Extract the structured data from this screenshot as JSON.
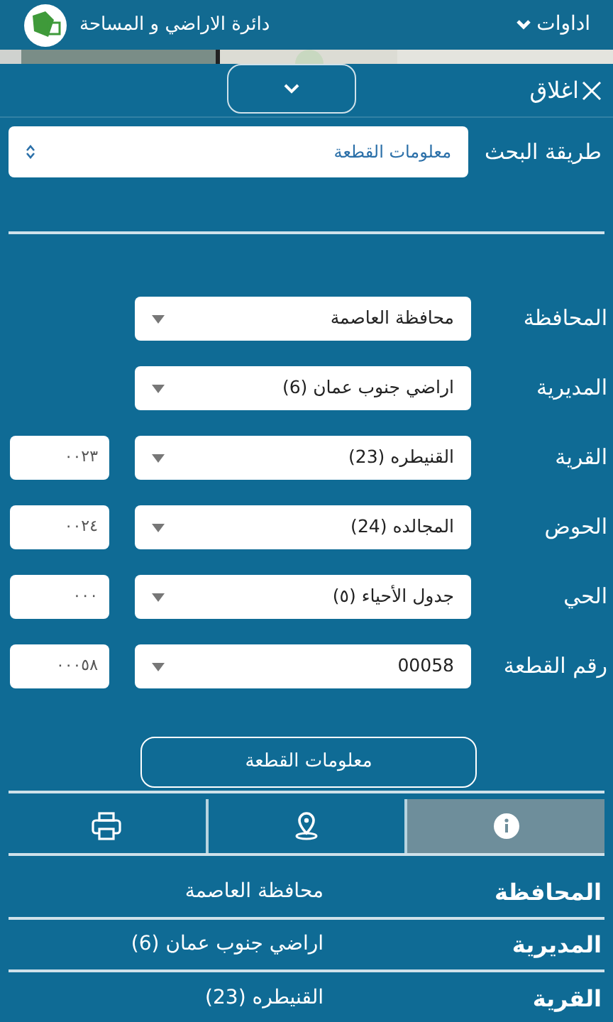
{
  "header": {
    "title": "دائرة الاراضي و المساحة",
    "menu": "اداوات"
  },
  "panel": {
    "close_label": "اغلاق"
  },
  "search_method": {
    "label": "طريقة البحث",
    "value": "معلومات القطعة"
  },
  "fields": [
    {
      "label": "المحافظة",
      "value": "محافظة العاصمة"
    },
    {
      "label": "المديرية",
      "value": "اراضي جنوب عمان (6)"
    },
    {
      "label": "القرية",
      "value": "القنيطره (23)",
      "code": "٠٠٢٣"
    },
    {
      "label": "الحوض",
      "value": "المجالده (24)",
      "code": "٠٠٢٤"
    },
    {
      "label": "الحي",
      "value": "جدول الأحياء (٥)",
      "code": "٠٠٠"
    },
    {
      "label": "رقم القطعة",
      "value": "00058",
      "code": "٠٠٠٥٨"
    }
  ],
  "submit_button": "معلومات القطعة",
  "tabs": [
    {
      "kind": "info",
      "selected": true
    },
    {
      "kind": "location",
      "selected": false
    },
    {
      "kind": "print",
      "selected": false
    }
  ],
  "info_rows": [
    {
      "label": "المحافظة",
      "value": "محافظة العاصمة"
    },
    {
      "label": "المديرية",
      "value": "اراضي جنوب عمان (6)"
    },
    {
      "label": "القرية",
      "value": "القنيطره (23)"
    }
  ]
}
